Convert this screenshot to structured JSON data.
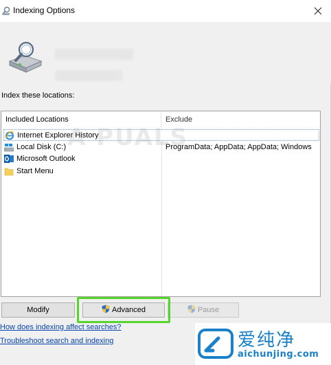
{
  "window": {
    "title": "Indexing Options",
    "close_icon": "close-icon"
  },
  "main": {
    "index_label": "Index these locations:",
    "columns": {
      "included": "Included Locations",
      "exclude": "Exclude"
    },
    "rows": [
      {
        "icon": "internet-explorer-icon",
        "location": "Internet Explorer History",
        "exclude": "",
        "selected": true
      },
      {
        "icon": "local-disk-icon",
        "location": "Local Disk (C:)",
        "exclude": "ProgramData; AppData; AppData; Windows",
        "selected": false
      },
      {
        "icon": "outlook-icon",
        "location": "Microsoft Outlook",
        "exclude": "",
        "selected": false
      },
      {
        "icon": "folder-icon",
        "location": "Start Menu",
        "exclude": "",
        "selected": false
      }
    ]
  },
  "buttons": {
    "modify": "Modify",
    "advanced": "Advanced",
    "pause": "Pause"
  },
  "links": {
    "how_indexing": "How does indexing affect searches?",
    "troubleshoot": "Troubleshoot search and indexing"
  },
  "watermark": {
    "appuals": "A  PUALS",
    "site_cn": "爱纯净",
    "site_en": "aichunjing.com"
  },
  "colors": {
    "highlight": "#55d42a",
    "link": "#0645ad",
    "brand": "#1a80c8"
  }
}
